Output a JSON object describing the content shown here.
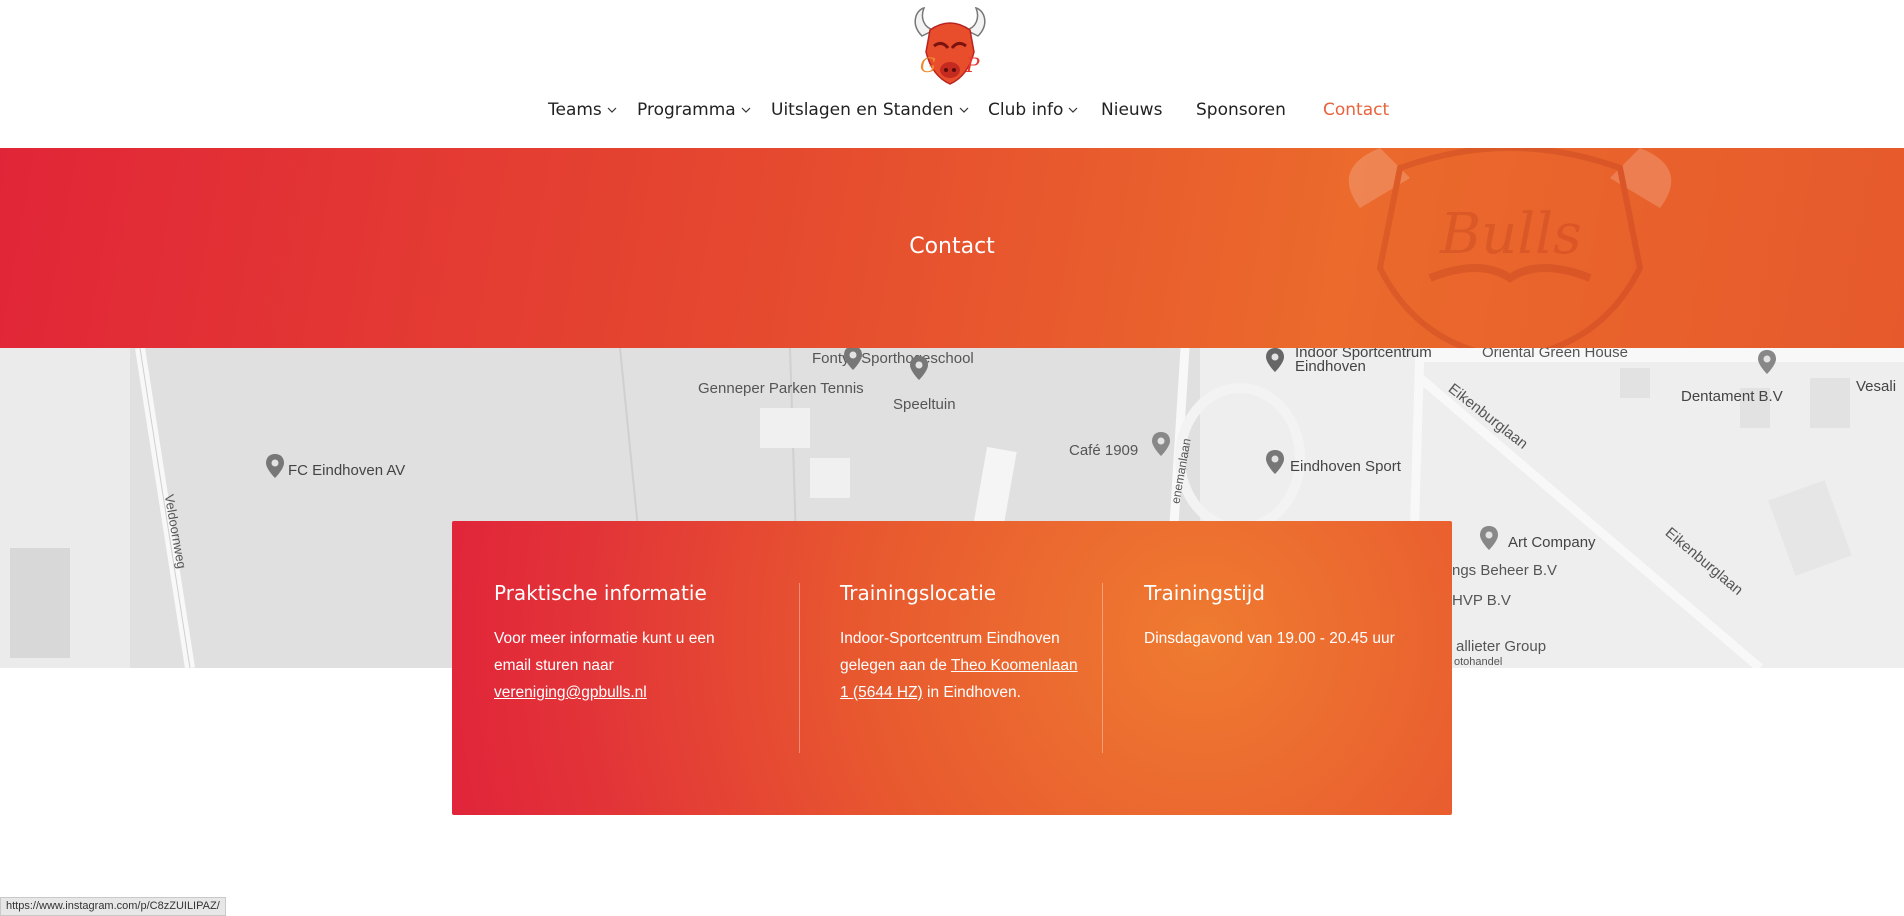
{
  "header": {
    "logo_alt": "GP Bulls",
    "nav": [
      {
        "label": "Teams",
        "dropdown": true
      },
      {
        "label": "Programma",
        "dropdown": true
      },
      {
        "label": "Uitslagen en Standen",
        "dropdown": true
      },
      {
        "label": "Club info",
        "dropdown": true
      },
      {
        "label": "Nieuws",
        "dropdown": false
      },
      {
        "label": "Sponsoren",
        "dropdown": false
      },
      {
        "label": "Contact",
        "dropdown": false,
        "active": true
      }
    ]
  },
  "hero": {
    "title": "Contact"
  },
  "map": {
    "labels": {
      "fontys": "Fontys Sporthogeschool",
      "genneper": "Genneper Parken Tennis",
      "speeltuin": "Speeltuin",
      "fc_eindhoven": "FC Eindhoven AV",
      "cafe": "Café 1909",
      "indoor1": "Indoor Sportcentrum",
      "indoor2": "Eindhoven",
      "oriental": "Oriental Green House",
      "dentament": "Dentament B.V",
      "vesali": "Vesali",
      "eikenburglaan1": "Eikenburglaan",
      "eikenburglaan2": "Eikenburglaan",
      "eindhoven_sport": "Eindhoven Sport",
      "art_company": "Art Company",
      "beheer": "ngs Beheer B.V",
      "hvp": "HVP B.V",
      "vallieter": "allieter Group",
      "veldoorn": "Veldoornweg",
      "menaan": "enemanlaan",
      "handel": "otohandel"
    }
  },
  "card": {
    "col1": {
      "title": "Praktische informatie",
      "text": "Voor meer informatie kunt u een email sturen naar",
      "link": "vereniging@gpbulls.nl"
    },
    "col2": {
      "title": "Trainingslocatie",
      "text_before": "Indoor-Sportcentrum Eindhoven gelegen aan de",
      "link": "Theo Koomenlaan 1 (5644 HZ)",
      "text_after": "in Eindhoven."
    },
    "col3": {
      "title": "Trainingstijd",
      "text": "Dinsdagavond van 19.00 - 20.45 uur"
    }
  },
  "status_bar": {
    "url": "https://www.instagram.com/p/C8zZUILIPAZ/"
  },
  "colors": {
    "accent": "#e8623a",
    "gradient_start": "#e1243a",
    "gradient_end": "#ef7b30"
  }
}
